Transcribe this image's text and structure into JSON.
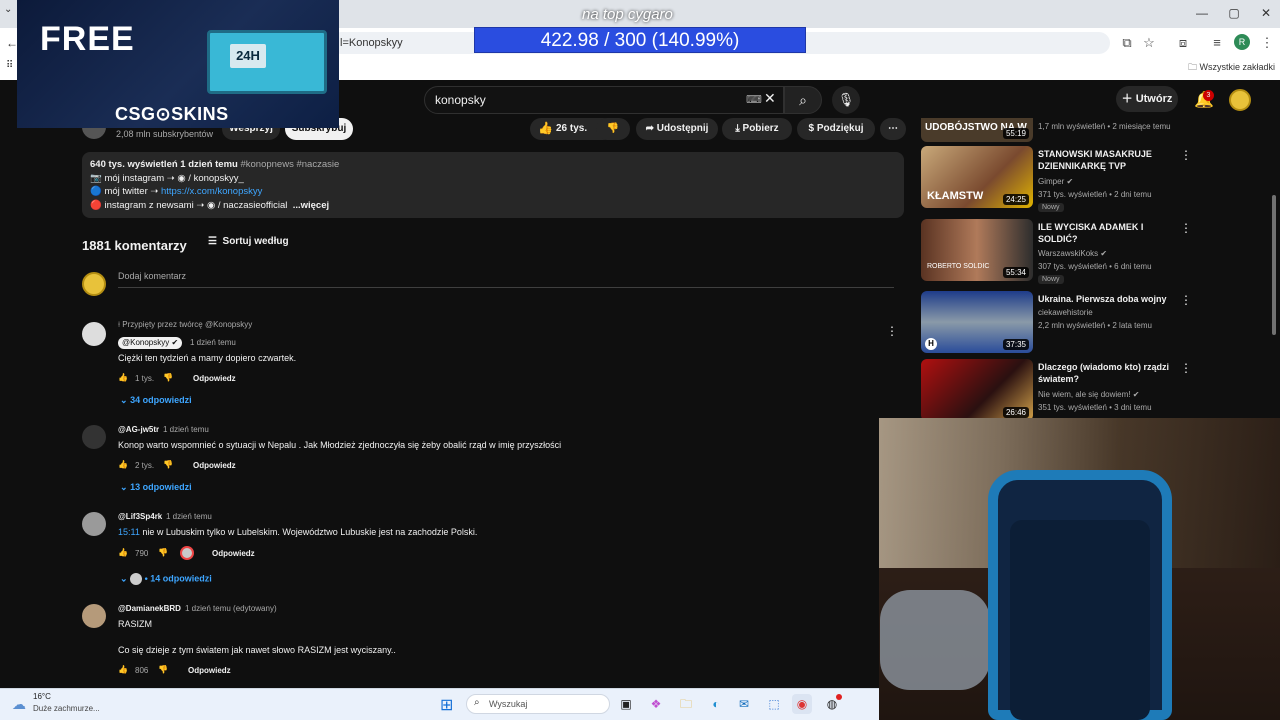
{
  "browser": {
    "url_fragment": "l=Konopskyy",
    "bookmarks_label": "Wszystkie zakładki",
    "profile_initial": "R"
  },
  "overlay": {
    "ad_free": "FREE",
    "ad_brand": "CSG⊙SKINS",
    "ad_case_label": "24H",
    "stream_text": "na top cygaro",
    "progress_text": "422.98 / 300 (140.99%)",
    "progress_color": "#2a4de0"
  },
  "youtube": {
    "search_value": "konopsky",
    "create_label": "Utwórz",
    "notifications_count": "3",
    "channel": {
      "subscribers": "2,08 mln subskrybentów",
      "join_label": "Wesprzyj",
      "subscribe_label": "Subskrybuj"
    },
    "actions": {
      "likes": "26 tys.",
      "share": "Udostępnij",
      "download": "Pobierz",
      "thanks": "Podziękuj"
    },
    "description": {
      "stats": "640 tys. wyświetleń  1 dzień temu",
      "hashtags": "#konopnews #naczasie",
      "line1_prefix": "📷 mój instagram ➝ ",
      "line1_link": "◉ / konopskyy_",
      "line2_prefix": "🔵 mój twitter ➝ ",
      "line2_link": "https://x.com/konopskyy",
      "line3_prefix": "🔴 instagram z newsami ➝ ",
      "line3_link": "◉ / naczasieofficial",
      "more": "...więcej"
    },
    "comments": {
      "count": "1881 komentarzy",
      "sort_label": "Sortuj według",
      "add_placeholder": "Dodaj komentarz",
      "reply_label": "Odpowiedz",
      "items": [
        {
          "pinned": "Przypięty przez twórcę @Konopskyy",
          "author": "@Konopskyy",
          "time": "1 dzień temu",
          "text": "Ciężki ten tydzień a mamy dopiero czwartek.",
          "likes": "1 tys.",
          "replies": "34 odpowiedzi"
        },
        {
          "author": "@AG-jw5tr",
          "time": "1 dzień temu",
          "text": "Konop warto wspomnieć o sytuacji w Nepalu . Jak Młodzież zjednoczyła się żeby obalić rząd w imię przyszłości",
          "likes": "2 tys.",
          "replies": "13 odpowiedzi"
        },
        {
          "author": "@Lif3Sp4rk",
          "time": "1 dzień temu",
          "timestamp_link": "15:11",
          "text": " nie w Lubuskim tylko w Lubelskim. Województwo Lubuskie jest na zachodzie Polski.",
          "likes": "790",
          "replies": "• 14 odpowiedzi"
        },
        {
          "author": "@DamianekBRD",
          "time": "1 dzień temu (edytowany)",
          "text": "RASIZM",
          "text2": "Co się dzieje z tym światem jak nawet słowo RASIZM jest wyciszany..",
          "likes": "806"
        }
      ]
    },
    "sidebar": {
      "top_meta": "1,7 mln wyświetleń • 2 miesiące temu",
      "top_duration": "55:19",
      "top_thumb_text": "UDOBÓJSTWO NA W",
      "items": [
        {
          "title": "STANOWSKI MASAKRUJE DZIENNIKARKĘ TVP",
          "channel": "Gimper",
          "meta": "371 tys. wyświetleń • 2 dni temu",
          "badge": "Nowy",
          "duration": "24:25",
          "thumb_text": "KŁAMSTW"
        },
        {
          "title": "ILE WYCISKA ADAMEK I SOLDIĆ?",
          "channel": "WarszawskiKoks",
          "meta": "307 tys. wyświetleń • 6 dni temu",
          "badge": "Nowy",
          "duration": "55:34",
          "thumb_text": "ROBERTO SOLDIC"
        },
        {
          "title": "Ukraina. Pierwsza doba wojny",
          "channel": "ciekawehistorie",
          "meta": "2,2 mln wyświetleń • 2 lata temu",
          "duration": "37:35"
        },
        {
          "title": "Dlaczego (wiadomo kto) rządzi światem?",
          "channel": "Nie wiem, ale się dowiem!",
          "meta": "351 tys. wyświetleń • 3 dni temu",
          "duration": "26:46"
        }
      ]
    }
  },
  "taskbar": {
    "temp": "16°C",
    "weather": "Duże zachmurze...",
    "search_label": "Wyszukaj"
  }
}
